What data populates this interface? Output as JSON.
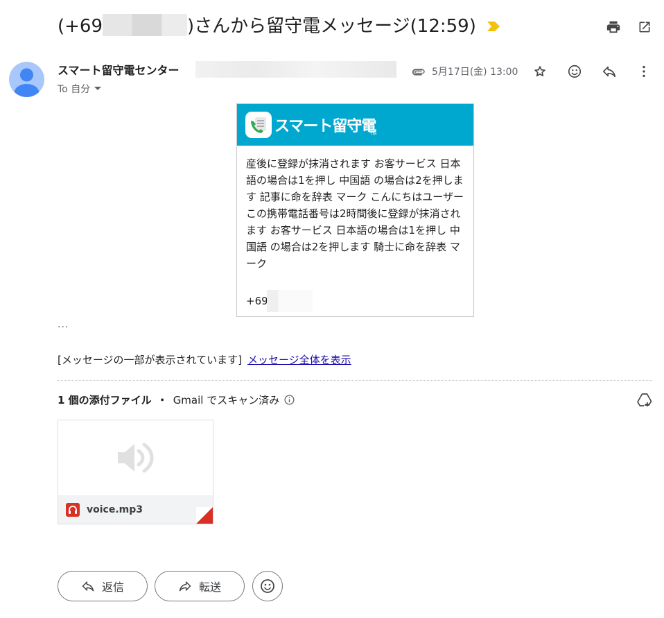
{
  "subject": {
    "prefix": "(+69",
    "suffix": ")さんから留守電メッセージ(12:59)"
  },
  "toolbar": {
    "print_icon": "printer-icon",
    "popout_icon": "open-in-new-window-icon",
    "importance_color": "#f4c20d"
  },
  "message": {
    "sender_name": "スマート留守電センター",
    "recipient_label": "To 自分",
    "date": "5月17日(金) 13:00",
    "icons": [
      "attachment-clip-icon",
      "star-icon",
      "emoji-icon",
      "reply-icon",
      "more-vertical-icon"
    ]
  },
  "card": {
    "brand": "スマート留守電",
    "tm": "TM",
    "header_color": "#00a8cf",
    "body_text": "産後に登録が抹消されます お客サービス 日本語の場合は1を押し 中国語 の場合は2を押します 記事に命を辞表 マーク こんにちはユーザー この携帯電話番号は2時間後に登録が抹消されます お客サービス 日本語の場合は1を押し 中国語 の場合は2を押します 騎士に命を辞表 マーク",
    "phone_prefix": "+69"
  },
  "ellipsis": "...",
  "trimmed": {
    "notice": "[メッセージの一部が表示されています]",
    "link": "メッセージ全体を表示"
  },
  "attachments": {
    "title": "1 個の添付ファイル",
    "separator": "・",
    "scan_status": "Gmail でスキャン済み",
    "file_name": "voice.mp3"
  },
  "actions": {
    "reply_label": "返信",
    "forward_label": "転送"
  }
}
